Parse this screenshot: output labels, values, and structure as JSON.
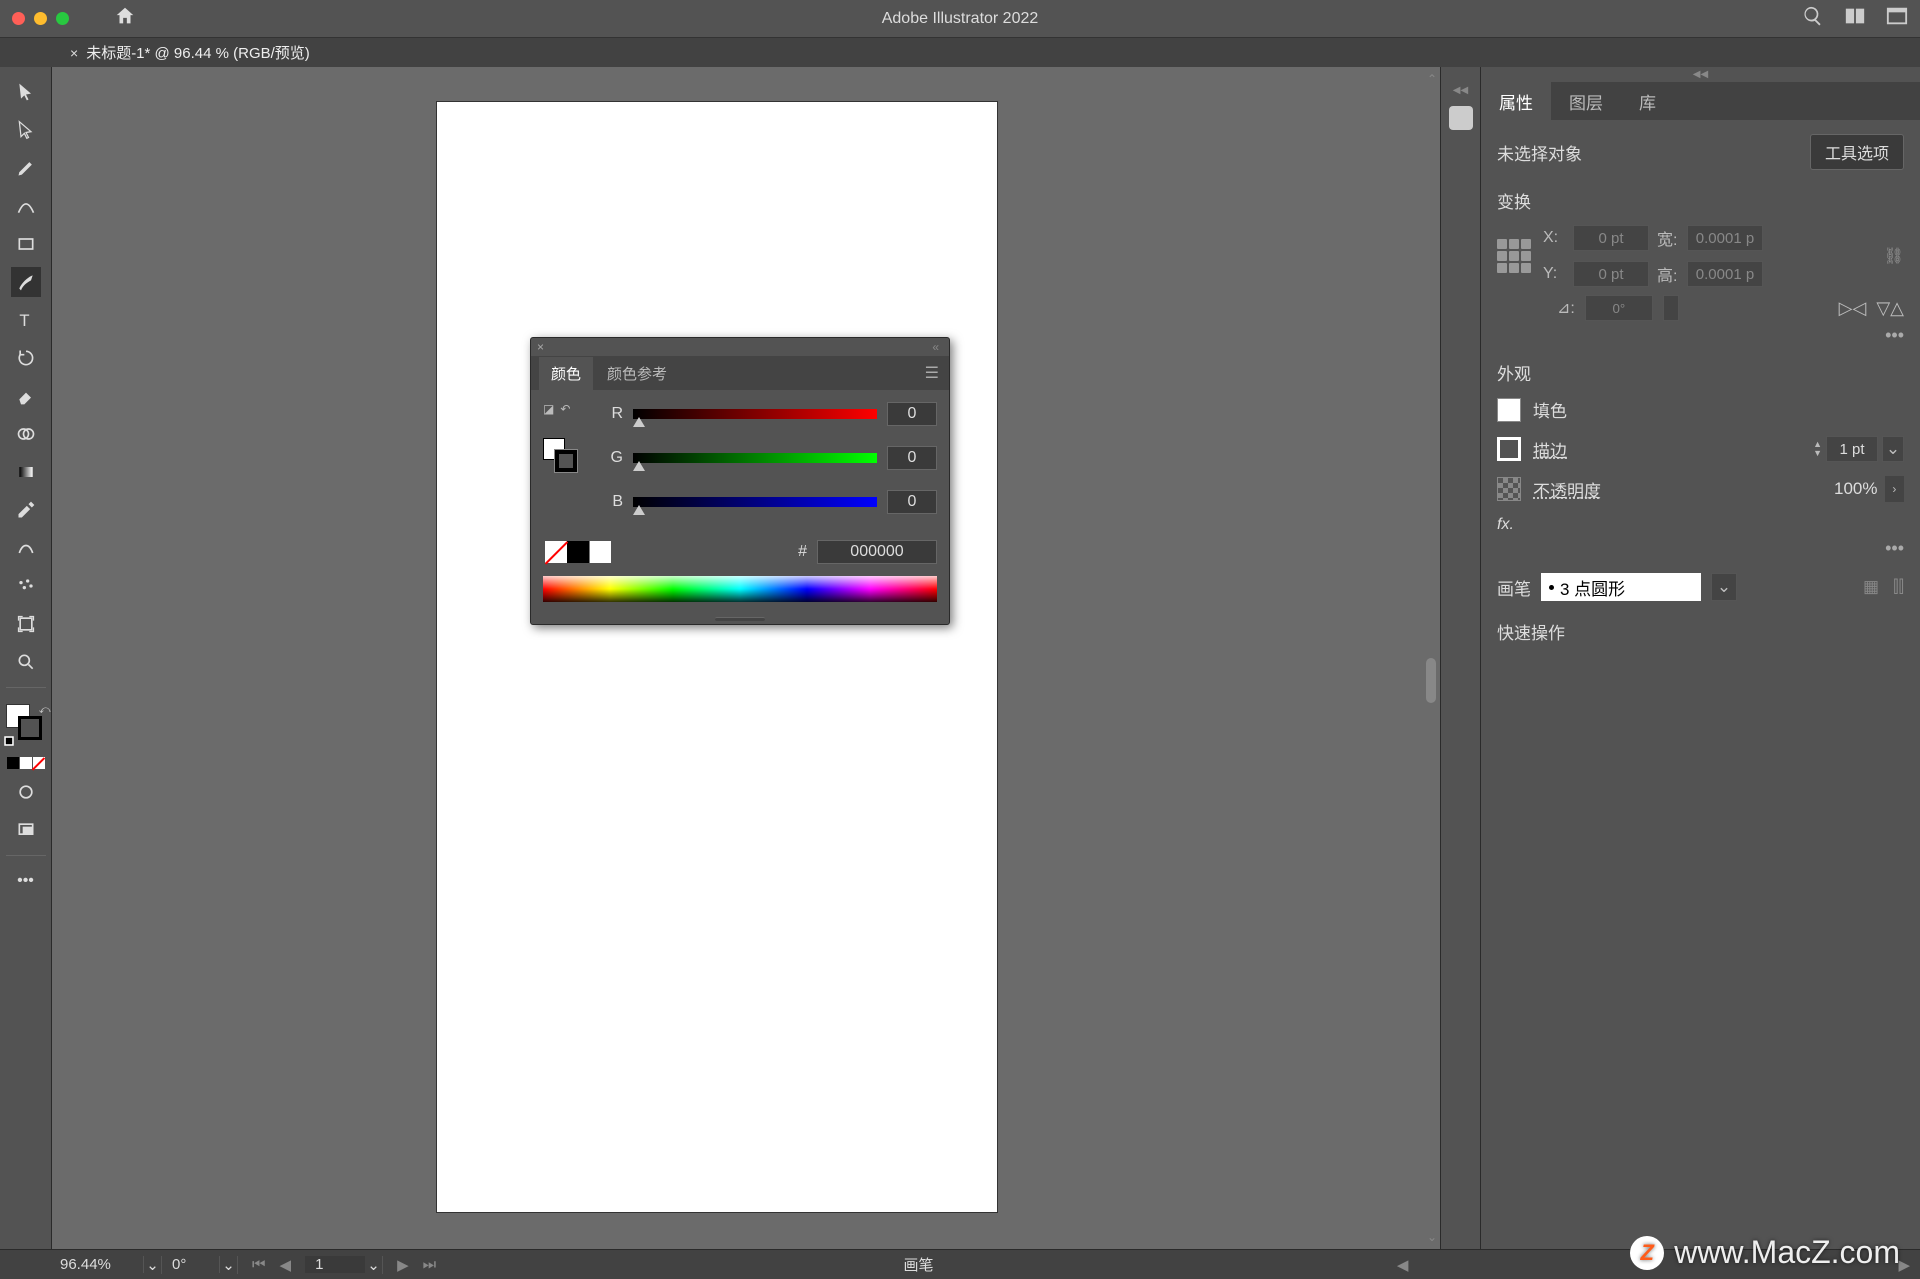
{
  "app_title": "Adobe Illustrator 2022",
  "doc_tab": "未标题-1* @ 96.44 % (RGB/预览)",
  "color_panel": {
    "tabs": [
      "颜色",
      "颜色参考"
    ],
    "r_label": "R",
    "g_label": "G",
    "b_label": "B",
    "r_value": "0",
    "g_value": "0",
    "b_value": "0",
    "hex_label": "#",
    "hex_value": "000000"
  },
  "right_tabs": [
    "属性",
    "图层",
    "库"
  ],
  "properties": {
    "selection": "未选择对象",
    "tool_options_btn": "工具选项",
    "transform_title": "变换",
    "x_label": "X:",
    "y_label": "Y:",
    "w_label": "宽:",
    "h_label": "高:",
    "x_value": "0 pt",
    "y_value": "0 pt",
    "w_value": "0.0001 p",
    "h_value": "0.0001 p",
    "rotate_value": "0°",
    "appearance_title": "外观",
    "fill_label": "填色",
    "stroke_label": "描边",
    "stroke_value": "1 pt",
    "opacity_label": "不透明度",
    "opacity_value": "100%",
    "fx_label": "fx.",
    "brush_label": "画笔",
    "brush_value": "3 点圆形",
    "quick_label": "快速操作"
  },
  "statusbar": {
    "zoom": "96.44%",
    "rotation": "0°",
    "artboard": "1",
    "tool_hint": "画笔"
  },
  "watermark": "www.MacZ.com"
}
